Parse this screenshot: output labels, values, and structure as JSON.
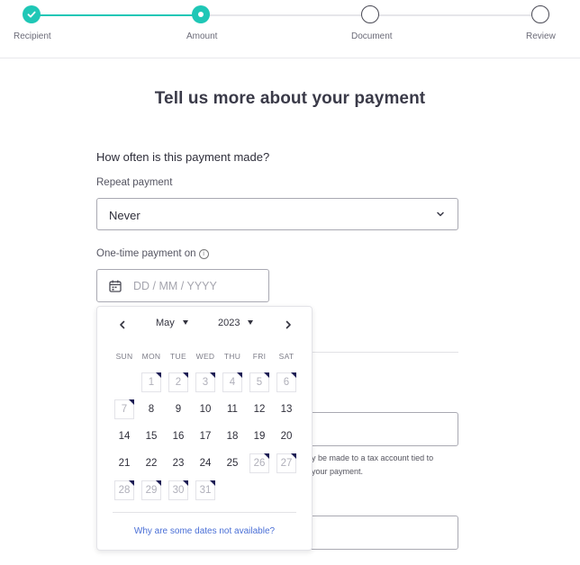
{
  "stepper": {
    "steps": [
      {
        "label": "Recipient",
        "state": "complete"
      },
      {
        "label": "Amount",
        "state": "current"
      },
      {
        "label": "Document",
        "state": "pending"
      },
      {
        "label": "Review",
        "state": "pending"
      }
    ],
    "accent_color": "#1fc7b6"
  },
  "page": {
    "title": "Tell us more about your payment",
    "frequency_question": "How often is this payment made?",
    "repeat_label": "Repeat payment",
    "repeat_value": "Never",
    "date_label": "One-time payment on",
    "date_placeholder": "DD / MM / YYYY"
  },
  "background": {
    "help_line_1": "y be made to a tax account tied to",
    "help_line_2": "your payment."
  },
  "calendar": {
    "month": "May",
    "year": "2023",
    "weekdays": [
      "SUN",
      "MON",
      "TUE",
      "WED",
      "THU",
      "FRI",
      "SAT"
    ],
    "weeks": [
      [
        {
          "d": ""
        },
        {
          "d": "1",
          "dis": true
        },
        {
          "d": "2",
          "dis": true
        },
        {
          "d": "3",
          "dis": true
        },
        {
          "d": "4",
          "dis": true
        },
        {
          "d": "5",
          "dis": true
        },
        {
          "d": "6",
          "dis": true
        }
      ],
      [
        {
          "d": "7",
          "dis": true
        },
        {
          "d": "8"
        },
        {
          "d": "9"
        },
        {
          "d": "10"
        },
        {
          "d": "11"
        },
        {
          "d": "12"
        },
        {
          "d": "13"
        }
      ],
      [
        {
          "d": "14"
        },
        {
          "d": "15"
        },
        {
          "d": "16"
        },
        {
          "d": "17"
        },
        {
          "d": "18"
        },
        {
          "d": "19"
        },
        {
          "d": "20"
        }
      ],
      [
        {
          "d": "21"
        },
        {
          "d": "22"
        },
        {
          "d": "23"
        },
        {
          "d": "24"
        },
        {
          "d": "25"
        },
        {
          "d": "26",
          "dis": true
        },
        {
          "d": "27",
          "dis": true
        }
      ],
      [
        {
          "d": "28",
          "dis": true
        },
        {
          "d": "29",
          "dis": true
        },
        {
          "d": "30",
          "dis": true
        },
        {
          "d": "31",
          "dis": true
        },
        {
          "d": ""
        },
        {
          "d": ""
        },
        {
          "d": ""
        }
      ]
    ],
    "footer_link": "Why are some dates not available?",
    "prev_icon": "chevron-left-icon",
    "next_icon": "chevron-right-icon"
  }
}
